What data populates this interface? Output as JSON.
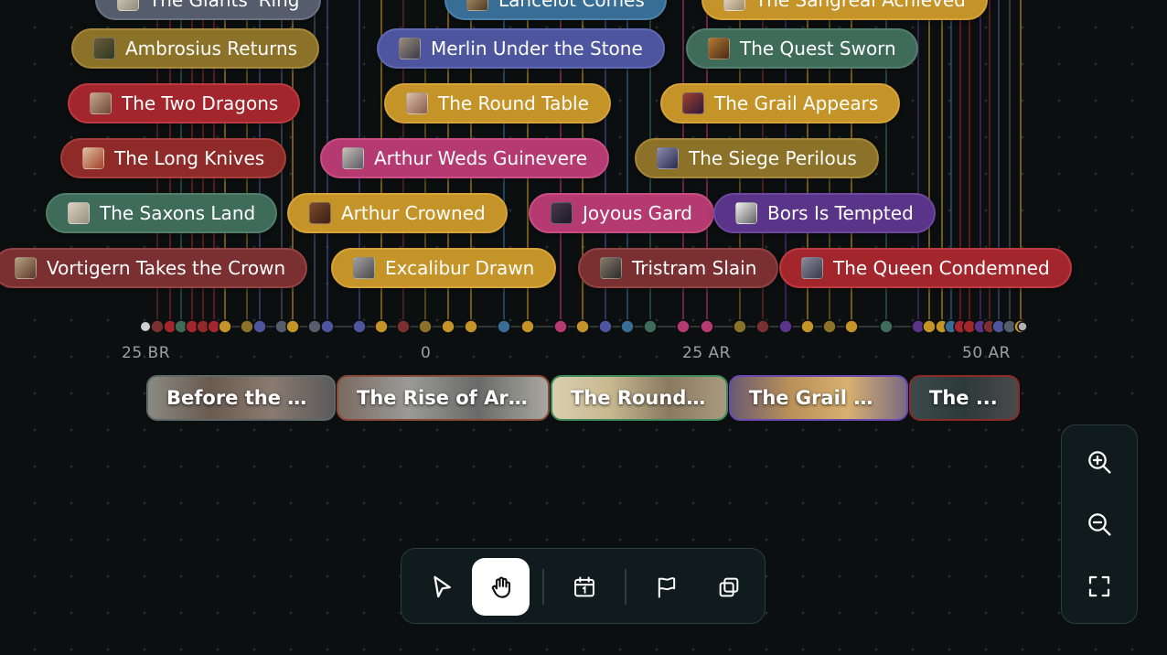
{
  "events": [
    {
      "label": "The Giants' Ring",
      "color": "slate"
    },
    {
      "label": "Lancelot Comes",
      "color": "steel"
    },
    {
      "label": "The Sangreal Achieved",
      "color": "gold"
    },
    {
      "label": "Ambrosius Returns",
      "color": "olive"
    },
    {
      "label": "Merlin Under the Stone",
      "color": "blue"
    },
    {
      "label": "The Quest Sworn",
      "color": "green"
    },
    {
      "label": "The Two Dragons",
      "color": "red"
    },
    {
      "label": "The Round Table",
      "color": "gold"
    },
    {
      "label": "The Grail Appears",
      "color": "gold"
    },
    {
      "label": "The Long Knives",
      "color": "dred"
    },
    {
      "label": "Arthur Weds Guinevere",
      "color": "pink"
    },
    {
      "label": "The Siege Perilous",
      "color": "olive"
    },
    {
      "label": "The Saxons Land",
      "color": "green"
    },
    {
      "label": "Arthur Crowned",
      "color": "gold"
    },
    {
      "label": "Joyous Gard",
      "color": "pink"
    },
    {
      "label": "Bors Is Tempted",
      "color": "purple"
    },
    {
      "label": "Vortigern Takes the Crown",
      "color": "maroon"
    },
    {
      "label": "Excalibur Drawn",
      "color": "gold"
    },
    {
      "label": "Tristram Slain",
      "color": "maroon"
    },
    {
      "label": "The Queen Condemned",
      "color": "red"
    }
  ],
  "axis": {
    "ticks": [
      "25 BR",
      "0",
      "25 AR",
      "50 AR"
    ]
  },
  "eras": [
    {
      "label": "Before the S..."
    },
    {
      "label": "The Rise of Art..."
    },
    {
      "label": "The Round ..."
    },
    {
      "label": "The Grail Q..."
    },
    {
      "label": "The ..."
    }
  ],
  "toolbar": {
    "tools": [
      {
        "name": "select",
        "icon": "cursor-arrow-icon",
        "active": false
      },
      {
        "name": "pan",
        "icon": "hand-icon",
        "active": true
      },
      {
        "name": "add-event",
        "icon": "calendar-icon",
        "active": false
      },
      {
        "name": "add-marker",
        "icon": "flag-icon",
        "active": false
      },
      {
        "name": "duplicate",
        "icon": "copy-icon",
        "active": false
      }
    ]
  },
  "zoom_controls": [
    {
      "name": "zoom-in",
      "icon": "zoom-in-icon"
    },
    {
      "name": "zoom-out",
      "icon": "zoom-out-icon"
    },
    {
      "name": "fit-to-screen",
      "icon": "fullscreen-icon"
    }
  ],
  "palette": {
    "gold": "#c59428",
    "olive": "#8c7128",
    "red": "#a3262c",
    "dred": "#8e2b28",
    "maroon": "#7a2f31",
    "green": "#3e6b5a",
    "blue": "#4d559e",
    "steel": "#386d95",
    "slate": "#555c6c",
    "pink": "#b53a72",
    "purple": "#5a3488"
  },
  "timeline_markers": [
    "maroon",
    "red",
    "green",
    "red",
    "dred",
    "red",
    "gold",
    "olive",
    "blue",
    "slate",
    "gold",
    "slate",
    "blue",
    "blue",
    "gold",
    "maroon",
    "olive",
    "gold",
    "gold",
    "steel",
    "gold",
    "pink",
    "gold",
    "blue",
    "steel",
    "green",
    "pink",
    "pink",
    "olive",
    "maroon",
    "purple",
    "gold",
    "olive",
    "gold",
    "green",
    "purple",
    "gold",
    "gold",
    "steel",
    "red",
    "red",
    "purple",
    "maroon",
    "blue",
    "slate",
    "gold",
    "grey"
  ]
}
